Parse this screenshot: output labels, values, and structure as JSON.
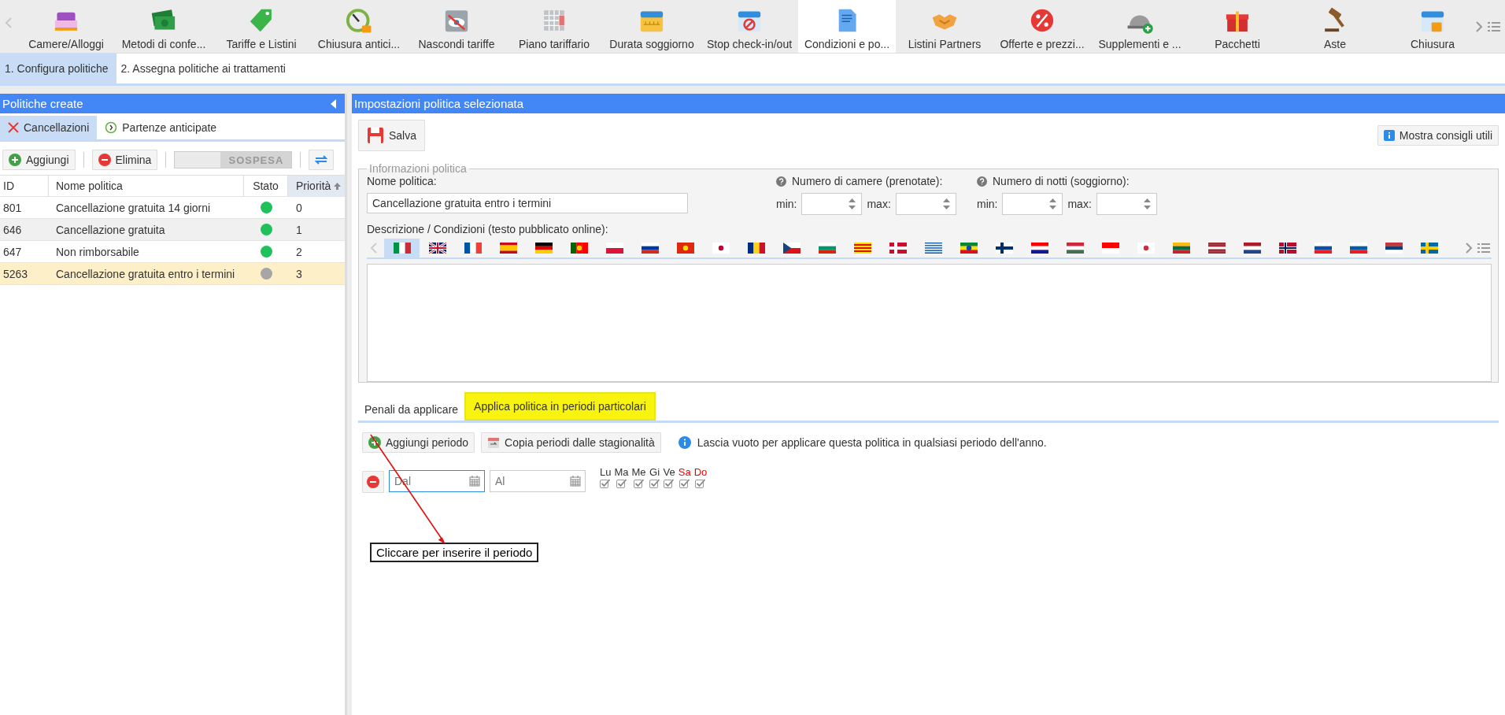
{
  "top_tabs": [
    {
      "label": "Camere/Alloggi",
      "selected": false
    },
    {
      "label": "Metodi di confe...",
      "selected": false
    },
    {
      "label": "Tariffe e Listini",
      "selected": false
    },
    {
      "label": "Chiusura antici...",
      "selected": false
    },
    {
      "label": "Nascondi tariffe",
      "selected": false
    },
    {
      "label": "Piano tariffario",
      "selected": false
    },
    {
      "label": "Durata soggiorno",
      "selected": false
    },
    {
      "label": "Stop check-in/out",
      "selected": false
    },
    {
      "label": "Condizioni e po...",
      "selected": true
    },
    {
      "label": "Listini Partners",
      "selected": false
    },
    {
      "label": "Offerte e prezzi...",
      "selected": false
    },
    {
      "label": "Supplementi e ...",
      "selected": false
    },
    {
      "label": "Pacchetti",
      "selected": false
    },
    {
      "label": "Aste",
      "selected": false
    },
    {
      "label": "Chiusura",
      "selected": false
    }
  ],
  "sub_tabs": [
    {
      "label": "1. Configura politiche",
      "selected": true
    },
    {
      "label": "2. Assegna politiche ai trattamenti",
      "selected": false
    }
  ],
  "left_panel": {
    "title": "Politiche create",
    "tabs": [
      {
        "label": "Cancellazioni",
        "selected": true
      },
      {
        "label": "Partenze anticipate",
        "selected": false
      }
    ],
    "add_button": "Aggiungi",
    "delete_button": "Elimina",
    "toggle": {
      "label": "SOSPESA",
      "on": false
    },
    "table": {
      "columns": [
        {
          "label": "ID",
          "sorted": false
        },
        {
          "label": "Nome politica",
          "sorted": false
        },
        {
          "label": "Stato",
          "sorted": false
        },
        {
          "label": "Priorità",
          "sorted": true
        }
      ],
      "rows": [
        {
          "id": "801",
          "name": "Cancellazione gratuita 14 giorni",
          "color": "#1ec15a",
          "priority": "0",
          "selected": false
        },
        {
          "id": "646",
          "name": "Cancellazione gratuita",
          "color": "#1ec15a",
          "priority": "1",
          "selected": false
        },
        {
          "id": "647",
          "name": "Non rimborsabile",
          "color": "#1ec15a",
          "priority": "2",
          "selected": false
        },
        {
          "id": "5263",
          "name": "Cancellazione gratuita entro i termini",
          "color": "#a6a6a6",
          "priority": "3",
          "selected": true
        }
      ]
    }
  },
  "right_panel": {
    "title": "Impostazioni politica selezionata",
    "save_button": "Salva",
    "tips_button": "Mostra consigli utili",
    "info": {
      "legend": "Informazioni politica",
      "name_label": "Nome politica:",
      "name_value": "Cancellazione gratuita entro i termini",
      "rooms": {
        "label": "Numero di camere (prenotate):",
        "min_label": "min:",
        "max_label": "max:"
      },
      "nights": {
        "label": "Numero di notti (soggiorno):",
        "min_label": "min:",
        "max_label": "max:"
      },
      "description_label": "Descrizione / Condizioni (testo pubblicato online):",
      "flags": [
        {
          "selected": true
        },
        {
          "selected": false
        },
        {
          "selected": false
        },
        {
          "selected": false
        },
        {
          "selected": false
        },
        {
          "selected": false
        },
        {
          "selected": false
        },
        {
          "selected": false
        },
        {
          "selected": false
        },
        {
          "selected": false
        },
        {
          "selected": false
        },
        {
          "selected": false
        },
        {
          "selected": false
        },
        {
          "selected": false
        },
        {
          "selected": false
        },
        {
          "selected": false
        },
        {
          "selected": false
        },
        {
          "selected": false
        },
        {
          "selected": false
        },
        {
          "selected": false
        },
        {
          "selected": false
        },
        {
          "selected": false
        },
        {
          "selected": false
        },
        {
          "selected": false
        },
        {
          "selected": false
        },
        {
          "selected": false
        },
        {
          "selected": false
        },
        {
          "selected": false
        },
        {
          "selected": false
        },
        {
          "selected": false
        }
      ]
    },
    "tabs": [
      {
        "label": "Penali da applicare",
        "selected": false
      },
      {
        "label": "Applica politica in periodi particolari",
        "selected": true
      }
    ],
    "add_period_button": "Aggiungi periodo",
    "copy_periods_button": "Copia periodi dalle stagionalità",
    "hint": "Lascia vuoto per applicare questa politica in qualsiasi periodo dell'anno.",
    "period": {
      "from_placeholder": "Dal",
      "to_placeholder": "Al",
      "days": [
        {
          "label": "Lu",
          "checked": true,
          "weekend": false
        },
        {
          "label": "Ma",
          "checked": true,
          "weekend": false
        },
        {
          "label": "Me",
          "checked": true,
          "weekend": false
        },
        {
          "label": "Gi",
          "checked": true,
          "weekend": false
        },
        {
          "label": "Ve",
          "checked": true,
          "weekend": false
        },
        {
          "label": "Sa",
          "checked": true,
          "weekend": true
        },
        {
          "label": "Do",
          "checked": true,
          "weekend": true
        }
      ]
    },
    "annotation": "Cliccare per inserire il periodo"
  }
}
